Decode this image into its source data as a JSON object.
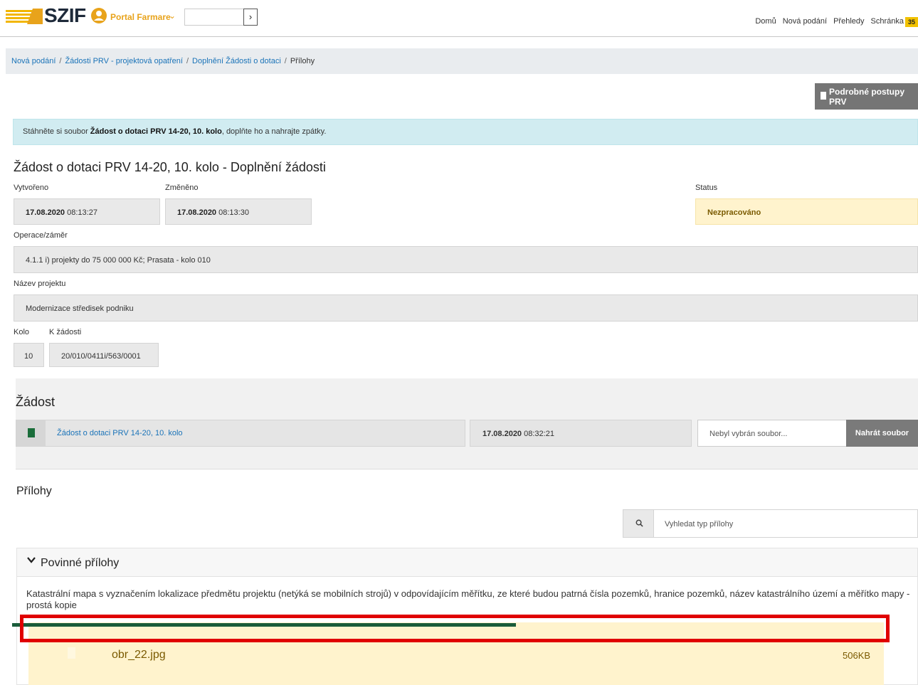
{
  "header": {
    "logo_text": "SZIF",
    "portal_label": "Portal Farmare",
    "nav": [
      "Domů",
      "Nová podání",
      "Přehledy",
      "Schránka"
    ],
    "badge_count": "35"
  },
  "breadcrumb": {
    "items": [
      "Nová podání",
      "Žádosti PRV - projektová opatření",
      "Doplnění Žádosti o dotaci"
    ],
    "current": "Přílohy"
  },
  "toolbar": {
    "postupy_label": "Podrobné postupy PRV"
  },
  "alert": {
    "prefix": "Stáhněte si soubor ",
    "bold": "Žádost o dotaci PRV 14-20, 10. kolo",
    "suffix": ", doplňte ho a nahrajte zpátky."
  },
  "page_title": "Žádost o dotaci PRV 14-20, 10. kolo - Doplnění žádosti",
  "form": {
    "created_label": "Vytvořeno",
    "created_date": "17.08.2020",
    "created_time": " 08:13:27",
    "changed_label": "Změněno",
    "changed_date": "17.08.2020",
    "changed_time": " 08:13:30",
    "status_label": "Status",
    "status_value": "Nezpracováno",
    "operace_label": "Operace/záměr",
    "operace_value": "4.1.1 i) projekty do 75 000 000 Kč; Prasata - kolo 010",
    "project_label": "Název projektu",
    "project_value": "Modernizace středisek podniku",
    "kolo_label": "Kolo",
    "kolo_value": "10",
    "kzadosti_label": "K žádosti",
    "kzadosti_value": "20/010/0411i/563/0001"
  },
  "zadost": {
    "title": "Žádost",
    "doc_link": "Žádost o dotaci PRV 14-20, 10. kolo",
    "doc_date": "17.08.2020",
    "doc_time": " 08:32:21",
    "file_placeholder": "Nebyl vybrán soubor...",
    "upload_label": "Nahrát soubor"
  },
  "prilohy": {
    "title": "Přílohy",
    "search_placeholder": "Vyhledat typ přílohy",
    "panel_title": "Povinné přílohy",
    "description": "Katastrální mapa s vyznačením lokalizace předmětu projektu (netýká se mobilních strojů) v odpovídajícím měřítku, ze které budou patrná čísla pozemků, hranice pozemků, název katastrálního území a měřítko mapy - prostá kopie",
    "file_name": "obr_22.jpg",
    "file_size": "506KB",
    "upload_progress": 0.58
  },
  "colors": {
    "accent": "#e8a31b",
    "link": "#1a73b8",
    "progress": "#1a5c3a",
    "highlight": "#e00000"
  }
}
